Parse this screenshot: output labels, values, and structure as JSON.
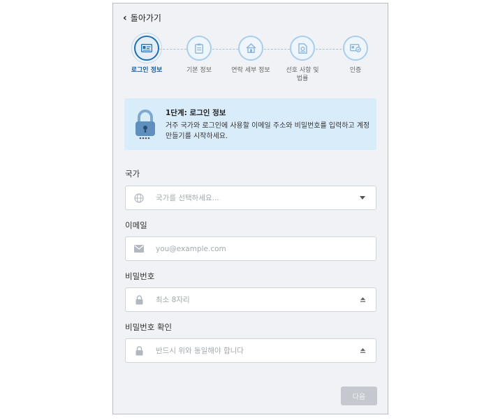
{
  "nav": {
    "back_label": "돌아가기"
  },
  "steps": [
    {
      "label": "로그인 정보",
      "icon": "id-card-icon",
      "active": true
    },
    {
      "label": "기본 정보",
      "icon": "clipboard-icon",
      "active": false
    },
    {
      "label": "연락 세부 정보",
      "icon": "home-icon",
      "active": false
    },
    {
      "label": "선호 사항 및 법률",
      "icon": "document-icon",
      "active": false
    },
    {
      "label": "인증",
      "icon": "verify-card-icon",
      "active": false
    }
  ],
  "info": {
    "title": "1단계: 로그인 정보",
    "text": "거주 국가와 로그인에 사용할 이메일 주소와 비밀번호를 입력하고 계정 만들기를 시작하세요."
  },
  "form": {
    "country": {
      "label": "국가",
      "placeholder": "국가를 선택하세요..."
    },
    "email": {
      "label": "이메일",
      "placeholder": "you@example.com"
    },
    "password": {
      "label": "비밀번호",
      "placeholder": "최소 8자리"
    },
    "confirm": {
      "label": "비밀번호 확인",
      "placeholder": "반드시 위와 동일해야 합니다"
    }
  },
  "actions": {
    "next_label": "다음"
  },
  "colors": {
    "accent": "#1f6fb2",
    "info_bg": "#d9ecfa",
    "disabled_button": "#c5c9cf"
  }
}
